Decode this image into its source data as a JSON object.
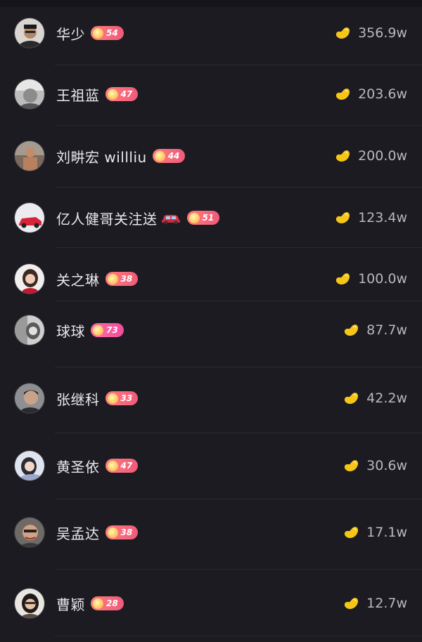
{
  "icons": {
    "bean": "bean-icon",
    "level_dot": "level-dot-icon",
    "car": "car-icon"
  },
  "colors": {
    "background": "#1c1b21",
    "badge_red": "#f05a7a",
    "badge_pink": "#f34b9a",
    "bean": "#f5c518"
  },
  "viewers": [
    {
      "name": "华少",
      "level": "54",
      "value": "356.9w",
      "car": false,
      "badge_style": "red"
    },
    {
      "name": "王祖蓝",
      "level": "47",
      "value": "203.6w",
      "car": false,
      "badge_style": "red"
    },
    {
      "name": "刘畊宏 willliu",
      "level": "44",
      "value": "200.0w",
      "car": false,
      "badge_style": "red"
    },
    {
      "name": "亿人健哥关注送",
      "level": "51",
      "value": "123.4w",
      "car": true,
      "badge_style": "red"
    },
    {
      "name": "关之琳",
      "level": "38",
      "value": "100.0w",
      "car": false,
      "badge_style": "red"
    },
    {
      "name": "球球",
      "level": "73",
      "value": "87.7w",
      "car": false,
      "badge_style": "pink"
    },
    {
      "name": "张继科",
      "level": "33",
      "value": "42.2w",
      "car": false,
      "badge_style": "red"
    },
    {
      "name": "黄圣依",
      "level": "47",
      "value": "30.6w",
      "car": false,
      "badge_style": "red"
    },
    {
      "name": "吴孟达",
      "level": "38",
      "value": "17.1w",
      "car": false,
      "badge_style": "red"
    },
    {
      "name": "曹颖",
      "level": "28",
      "value": "12.7w",
      "car": false,
      "badge_style": "red"
    }
  ]
}
